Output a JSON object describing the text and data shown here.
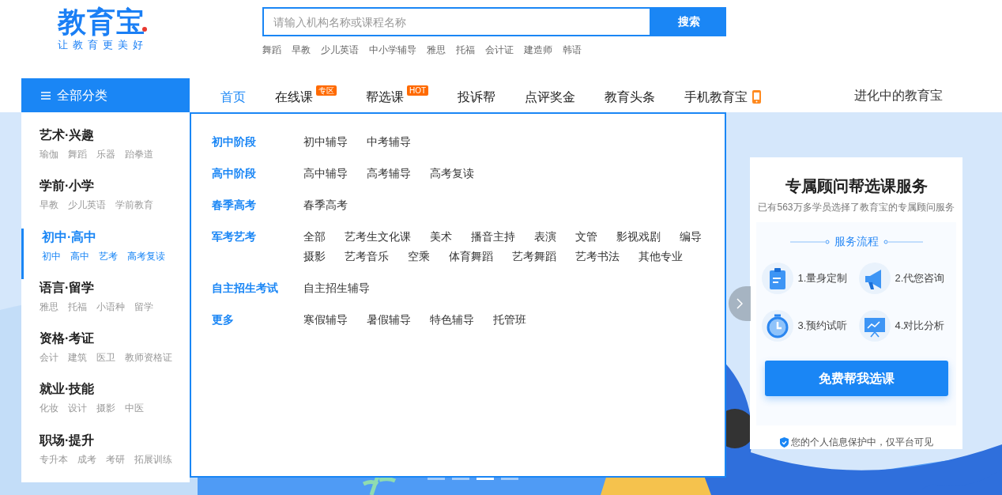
{
  "logo": {
    "title": "教育宝",
    "slogan": "让教育更美好"
  },
  "search": {
    "placeholder": "请输入机构名称或课程名称",
    "button": "搜索"
  },
  "hot_searches": [
    "舞蹈",
    "早教",
    "少儿英语",
    "中小学辅导",
    "雅思",
    "托福",
    "会计证",
    "建造师",
    "韩语"
  ],
  "nav": {
    "all_categories": "全部分类",
    "items": [
      {
        "kind": "text",
        "label": "首页",
        "selected": true
      },
      {
        "kind": "badge",
        "label": "在线课",
        "badge": "专区",
        "selected": false
      },
      {
        "kind": "badge",
        "label": "帮选课",
        "badge": "HOT",
        "selected": false
      },
      {
        "kind": "text",
        "label": "投诉帮",
        "selected": false
      },
      {
        "kind": "text",
        "label": "点评奖金",
        "selected": false
      },
      {
        "kind": "text",
        "label": "教育头条",
        "selected": false
      },
      {
        "kind": "phone",
        "label": "手机教育宝",
        "selected": false
      }
    ],
    "right_link": "进化中的教育宝"
  },
  "categories": [
    {
      "title": "艺术·兴趣",
      "subs": [
        "瑜伽",
        "舞蹈",
        "乐器",
        "跆拳道"
      ],
      "selected": false
    },
    {
      "title": "学前·小学",
      "subs": [
        "早教",
        "少儿英语",
        "学前教育"
      ],
      "selected": false
    },
    {
      "title": "初中·高中",
      "subs": [
        "初中",
        "高中",
        "艺考",
        "高考复读"
      ],
      "selected": true
    },
    {
      "title": "语言·留学",
      "subs": [
        "雅思",
        "托福",
        "小语种",
        "留学"
      ],
      "selected": false
    },
    {
      "title": "资格·考证",
      "subs": [
        "会计",
        "建筑",
        "医卫",
        "教师资格证"
      ],
      "selected": false
    },
    {
      "title": "就业·技能",
      "subs": [
        "化妆",
        "设计",
        "摄影",
        "中医"
      ],
      "selected": false
    },
    {
      "title": "职场·提升",
      "subs": [
        "专升本",
        "成考",
        "考研",
        "拓展训练"
      ],
      "selected": false
    }
  ],
  "dropdown": [
    {
      "heading": "初中阶段",
      "links": [
        "初中辅导",
        "中考辅导"
      ]
    },
    {
      "heading": "高中阶段",
      "links": [
        "高中辅导",
        "高考辅导",
        "高考复读"
      ]
    },
    {
      "heading": "春季高考",
      "links": [
        "春季高考"
      ]
    },
    {
      "heading": "军考艺考",
      "links": [
        "全部",
        "艺考生文化课",
        "美术",
        "播音主持",
        "表演",
        "文管",
        "影视戏剧",
        "编导",
        "摄影",
        "艺考音乐",
        "空乘",
        "体育舞蹈",
        "艺考舞蹈",
        "艺考书法",
        "其他专业"
      ]
    },
    {
      "heading": "自主招生考试",
      "links": [
        "自主招生辅导"
      ]
    },
    {
      "heading": "更多",
      "links": [
        "寒假辅导",
        "暑假辅导",
        "特色辅导",
        "托管班"
      ]
    }
  ],
  "advisor": {
    "title": "专属顾问帮选课服务",
    "subtitle": "已有563万多学员选择了教育宝的专属顾问服务",
    "process_title": "服务流程",
    "steps": [
      {
        "kind": "clipboard",
        "label": "1.量身定制"
      },
      {
        "kind": "megaphone",
        "label": "2.代您咨询"
      },
      {
        "kind": "stopwatch",
        "label": "3.预约试听"
      },
      {
        "kind": "board",
        "label": "4.对比分析"
      }
    ],
    "button": "免费帮我选课",
    "privacy": "您的个人信息保护中，仅平台可见"
  },
  "carousel": {
    "dots": [
      {
        "selected": false
      },
      {
        "selected": false
      },
      {
        "selected": true
      },
      {
        "selected": false
      }
    ]
  }
}
